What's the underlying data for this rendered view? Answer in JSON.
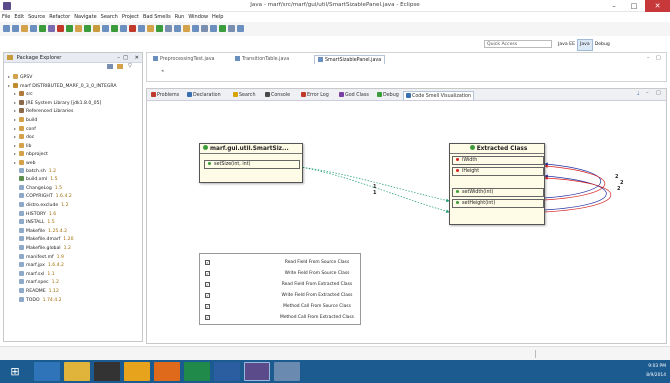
{
  "window": {
    "title": "Java - marf/src/marf/gui/util/SmartSizablePanel.java - Eclipse",
    "min": "–",
    "max": "□",
    "close": "✕"
  },
  "menu": [
    "File",
    "Edit",
    "Source",
    "Refactor",
    "Navigate",
    "Search",
    "Project",
    "Bad Smells",
    "Run",
    "Window",
    "Help"
  ],
  "quick_access": {
    "placeholder": "Quick Access"
  },
  "perspectives": [
    {
      "label": "Java EE",
      "active": false
    },
    {
      "label": "Java",
      "active": true
    },
    {
      "label": "Debug",
      "active": false
    }
  ],
  "package_explorer": {
    "title": "Package Explorer",
    "items": [
      {
        "label": "GPSV",
        "type": "folder",
        "depth": 0
      },
      {
        "label": "marf DISTRIBUTED_MARF_0_3_0_INTEGRA",
        "type": "project",
        "depth": 0
      },
      {
        "label": "src",
        "type": "src",
        "depth": 1
      },
      {
        "label": "JRE System Library [jdk1.8.0_05]",
        "type": "lib",
        "depth": 1
      },
      {
        "label": "Referenced Libraries",
        "type": "lib",
        "depth": 1
      },
      {
        "label": "build",
        "type": "folder",
        "depth": 1
      },
      {
        "label": "conf",
        "type": "folder",
        "depth": 1
      },
      {
        "label": "doc",
        "type": "folder",
        "depth": 1
      },
      {
        "label": "lib",
        "type": "folder",
        "depth": 1
      },
      {
        "label": "nbproject",
        "type": "folder",
        "depth": 1
      },
      {
        "label": "web",
        "type": "folder",
        "depth": 1
      },
      {
        "label": "batch.sh",
        "version": "1.2",
        "type": "file",
        "depth": 1
      },
      {
        "label": "build.xml",
        "version": "1.5",
        "type": "xml",
        "depth": 1
      },
      {
        "label": "ChangeLog",
        "version": "1.5",
        "type": "file",
        "depth": 1
      },
      {
        "label": "COPYRIGHT",
        "version": "1.6.4.2",
        "type": "file",
        "depth": 1
      },
      {
        "label": "distro.exclude",
        "version": "1.2",
        "type": "file",
        "depth": 1
      },
      {
        "label": "HISTORY",
        "version": "1.6",
        "type": "file",
        "depth": 1
      },
      {
        "label": "INSTALL",
        "version": "1.5",
        "type": "file",
        "depth": 1
      },
      {
        "label": "Makefile",
        "version": "1.25.4.2",
        "type": "file",
        "depth": 1
      },
      {
        "label": "Makefile.dmarf",
        "version": "1.20",
        "type": "file",
        "depth": 1
      },
      {
        "label": "Makefile.global",
        "version": "1.2",
        "type": "file",
        "depth": 1
      },
      {
        "label": "manifest.mf",
        "version": "1.9",
        "type": "file",
        "depth": 1
      },
      {
        "label": "marf.jpx",
        "version": "1.6.4.2",
        "type": "file",
        "depth": 1
      },
      {
        "label": "marf.sxl",
        "version": "1.1",
        "type": "file",
        "depth": 1
      },
      {
        "label": "marf.spec",
        "version": "1.2",
        "type": "file",
        "depth": 1
      },
      {
        "label": "README",
        "version": "1.12",
        "type": "file",
        "depth": 1
      },
      {
        "label": "TODO",
        "version": "1.74.4.2",
        "type": "file",
        "depth": 1
      }
    ]
  },
  "editor_tabs": [
    {
      "label": "PreprocessingTest.java",
      "active": false
    },
    {
      "label": "TransitionTable.java",
      "active": false
    },
    {
      "label": "SmartSizablePanel.java",
      "active": true
    }
  ],
  "view_tabs": [
    {
      "label": "Problems",
      "icon": "problems-icon",
      "color": "#c0392b"
    },
    {
      "label": "Declaration",
      "icon": "declaration-icon",
      "color": "#3a6fb0"
    },
    {
      "label": "Search",
      "icon": "search-icon",
      "color": "#d9a300"
    },
    {
      "label": "Console",
      "icon": "console-icon",
      "color": "#4a4a4a"
    },
    {
      "label": "Error Log",
      "icon": "error-log-icon",
      "color": "#c0392b"
    },
    {
      "label": "God Class",
      "icon": "god-class-icon",
      "color": "#7a3fa3"
    },
    {
      "label": "Debug",
      "icon": "debug-icon",
      "color": "#3b9c3b"
    },
    {
      "label": "Code Smell Visualization",
      "icon": "code-smell-icon",
      "color": "#3a6fb0",
      "active": true
    }
  ],
  "diagram": {
    "source_class": {
      "title": "marf.gui.util.SmartSiz...",
      "members": [
        "setSize(int, int)"
      ]
    },
    "extracted_class": {
      "title": "Extracted Class",
      "fields": [
        "iWidth",
        "iHeight"
      ],
      "methods": [
        "setWidth(int)",
        "setHeight(int)"
      ]
    },
    "edge_labels": [
      "1",
      "1"
    ],
    "self_edge_labels": [
      "2",
      "2",
      "2"
    ]
  },
  "legend": [
    {
      "label": "Read Field From Source Class",
      "color": "#1f2f9f",
      "style": "solid"
    },
    {
      "label": "Write Field From Source Class",
      "color": "#d62020",
      "style": "dotted"
    },
    {
      "label": "Read Field From Extracted Class",
      "color": "#1f2f9f",
      "style": "solid"
    },
    {
      "label": "Write Field From Extracted Class",
      "color": "#d62020",
      "style": "solid"
    },
    {
      "label": "Method Call From Source Class",
      "color": "#1a9c6a",
      "style": "dotted"
    },
    {
      "label": "Method Call From Extracted Class",
      "color": "#1a9c6a",
      "style": "solid"
    }
  ],
  "taskbar": {
    "time": "9:03 PM",
    "date": "8/9/2014"
  }
}
